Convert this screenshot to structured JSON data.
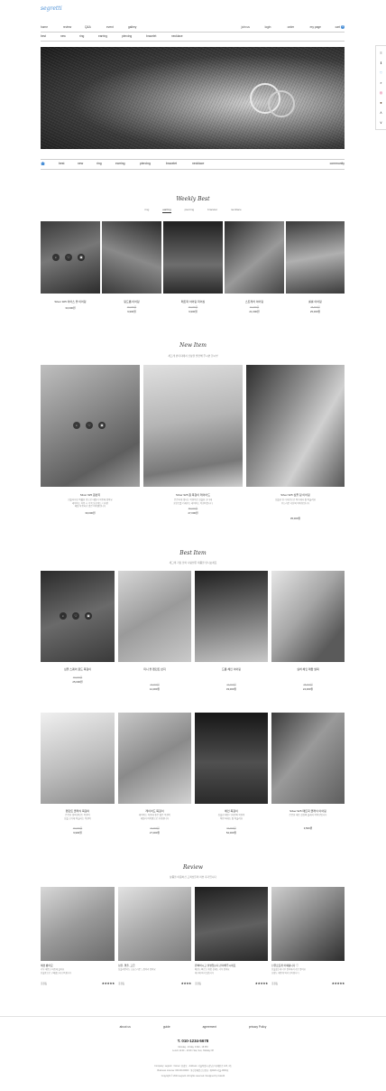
{
  "brand": {
    "logo": "segretti"
  },
  "colors": {
    "accent": "#4a8fd6"
  },
  "top_nav": {
    "left": [
      "home",
      "review",
      "Q&A",
      "event",
      "gallery"
    ],
    "right": [
      "join us",
      "login",
      "order",
      "my page",
      "cart",
      "0"
    ]
  },
  "sub_nav": [
    "best",
    "new",
    "ring",
    "earring",
    "piercing",
    "bracelet",
    "necklace"
  ],
  "category_nav": {
    "items": [
      "best",
      "new",
      "ring",
      "earring",
      "piercing",
      "bracelet",
      "necklace"
    ],
    "right": "community"
  },
  "weekly_best": {
    "title": "Weekly Best",
    "tabs": [
      "ring",
      "earring",
      "piercing",
      "bracelet",
      "necklace"
    ],
    "active_tab": "earring",
    "products": [
      {
        "name": "Silver 925 이어스 볼 이어링",
        "price": "33,000원"
      },
      {
        "name": "링드롭 이어링",
        "old": "15,000원",
        "price": "9,900원"
      },
      {
        "name": "매트럭 이어링 피어싱",
        "old": "15,000원",
        "price": "9,900원"
      },
      {
        "name": "스트레치 이어링",
        "old": "21,000원",
        "price": "21,000원"
      },
      {
        "name": "롤롤 이어링",
        "old": "25,000원",
        "price": "25,000원"
      }
    ]
  },
  "new_item": {
    "title": "New Item",
    "subtitle": "세그레 빈티지에서 신상을 발견해 주시면 한시부",
    "products": [
      {
        "name": "Silver 925 원반지",
        "desc": [
          "심플하지만 특별한 링으로 데일리 착용에 좋아요",
          "레이어드 착용 시 더욱 돋보이는 디자인",
          "매일 착용하기 좋은 아이템입니다"
        ],
        "price": "30,000원"
      },
      {
        "name": "Silver 925 원 목걸이 레이어드",
        "desc": [
          "은은하게 빛나는 목걸이로 심플한 코디에",
          "포인트를 더해주는 레이어드 목걸이입니다"
        ],
        "old": "55,000원",
        "price": "47,000원"
      },
      {
        "name": "Silver 925 심플 링 이어링",
        "desc": [
          "심플한 링 디자인으로 어디에나 잘 어울려요",
          "부드러운 곡선의 이어링입니다"
        ],
        "price": "35,000원"
      }
    ]
  },
  "best_item": {
    "title": "Best Item",
    "subtitle": "세그레 가장 많이 사랑받은 제품을 만나보세요",
    "products": [
      {
        "name": "심플 스퀘어 골드 목걸이",
        "old": "30,000원",
        "price": "25,000원"
      },
      {
        "name": "미니 볼 펜던트 반지",
        "old": "16,000원",
        "price": "12,000원"
      },
      {
        "name": "드롭 체인 이어링",
        "old": "44,000원",
        "price": "33,000원"
      },
      {
        "name": "실버 체인 매듭 팔찌",
        "old": "28,000원",
        "price": "24,000원"
      },
      {
        "name": "펜던트 클래식 목걸이",
        "desc": [
          "은은한 빛의 펜던트 목걸이",
          "심플 코디에 어울리는 목걸이"
        ],
        "old": "15,000원",
        "price": "9,900원"
      },
      {
        "name": "레이어드 목걸이",
        "desc": [
          "레이어드 착용에 좋은 얇은 목걸이",
          "데일리 아이템으로 추천합니다"
        ],
        "old": "32,000원",
        "price": "27,000원"
      },
      {
        "name": "체인 목걸이",
        "desc": [
          "심플한 체인 디자인의 목걸이",
          "어떤 룩에도 잘 어울려요"
        ],
        "old": "60,000원",
        "price": "52,000원"
      },
      {
        "name": "Silver 925 매트릭 클래식 이어링",
        "desc": [
          "은은한 매트 질감의 클래식 이어링입니다"
        ],
        "price": "3,500원"
      }
    ]
  },
  "review": {
    "title": "Review",
    "subtitle": "상품을 이용하신 고객님들의 리뷰 후기입니다",
    "items": [
      {
        "title": "예쁘 봤어요",
        "text": [
          "너무 예쁘고 마음에 들어요",
          "선물용으로 구매했는데 만족합니다"
        ],
        "author": "홍길동",
        "stars": "★★★★★"
      },
      {
        "title": "심플, 결플, 고급",
        "text": [
          "심플하면서도 고급스러운 느낌이라 좋아요"
        ],
        "author": "홍길동",
        "stars": "★★★★"
      },
      {
        "title": "완벽하시고 설명있는지 관리해주시네요",
        "text": [
          "배송도 빠르고 제품 상태도 너무 좋아요",
          "재구매 의사 있습니다"
        ],
        "author": "홍길동",
        "stars": "★★★★★"
      },
      {
        "title": "선물로요게 어째욥니다 ♡",
        "text": [
          "선물했는데 너무 좋아해서 기분 좋아요",
          "포장도 예쁘게 와서 만족합니다"
        ],
        "author": "홍길동",
        "stars": "★★★★★"
      }
    ]
  },
  "footer": {
    "links": [
      "about us",
      "guide",
      "agreement",
      "privacy Policy"
    ],
    "phone": "T. 010-1234-5678",
    "hours": [
      "Monday - Friday. 9 AM - 18 PM",
      "Lunch 12:00 - 13:00 / Sat, Sun, Holiday Off"
    ],
    "company": [
      "Company: segretti",
      "Owner: 홍길동",
      "Address: 서울특별시 강남구 테헤란로 123, 4층",
      "Business License: 000-00-00000",
      "통신판매업신고번호: 제2024-서울-0000호"
    ],
    "copyright": "Copyright © 2024 segretti. All rights reserved. Designed by Cafe24"
  },
  "side_bar": [
    "≡",
    "ℹ",
    "♡",
    "⌕",
    "◎",
    "●",
    "∧",
    "∨"
  ]
}
